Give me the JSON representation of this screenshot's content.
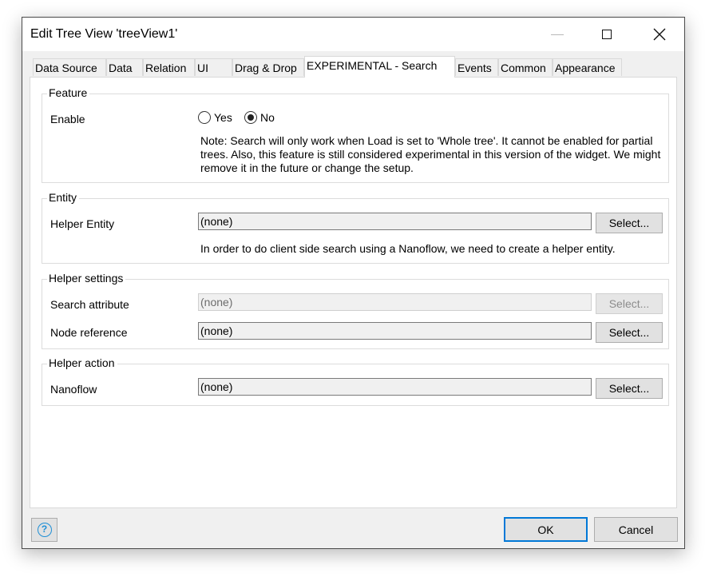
{
  "window": {
    "title": "Edit Tree View 'treeView1'"
  },
  "tabs": [
    {
      "label": "Data Source"
    },
    {
      "label": "Data"
    },
    {
      "label": "Relation"
    },
    {
      "label": "UI"
    },
    {
      "label": "Drag & Drop"
    },
    {
      "label": "EXPERIMENTAL - Search",
      "active": true
    },
    {
      "label": "Events"
    },
    {
      "label": "Common"
    },
    {
      "label": "Appearance"
    }
  ],
  "feature": {
    "title": "Feature",
    "enable_label": "Enable",
    "yes_label": "Yes",
    "no_label": "No",
    "selected": "No",
    "note": "Note: Search will only work when Load is set to 'Whole tree'. It cannot be enabled for partial trees. Also, this feature is still considered experimental in this version of the widget. We might remove it in the future or change the setup."
  },
  "entity": {
    "title": "Entity",
    "helper_entity_label": "Helper Entity",
    "helper_entity_value": "(none)",
    "select_label": "Select...",
    "note": "In order to do client side search using a Nanoflow, we need to create a helper entity."
  },
  "helper_settings": {
    "title": "Helper settings",
    "search_attribute_label": "Search attribute",
    "search_attribute_value": "(none)",
    "search_attribute_select": "Select...",
    "node_reference_label": "Node reference",
    "node_reference_value": "(none)",
    "node_reference_select": "Select..."
  },
  "helper_action": {
    "title": "Helper action",
    "nanoflow_label": "Nanoflow",
    "nanoflow_value": "(none)",
    "nanoflow_select": "Select..."
  },
  "footer": {
    "help_glyph": "?",
    "ok_label": "OK",
    "cancel_label": "Cancel"
  },
  "colors": {
    "accent": "#0078d7",
    "help_icon": "#1e8fd6"
  },
  "icons": {
    "minimize": "minimize-icon",
    "maximize": "maximize-icon",
    "close": "close-icon",
    "help": "help-icon"
  }
}
